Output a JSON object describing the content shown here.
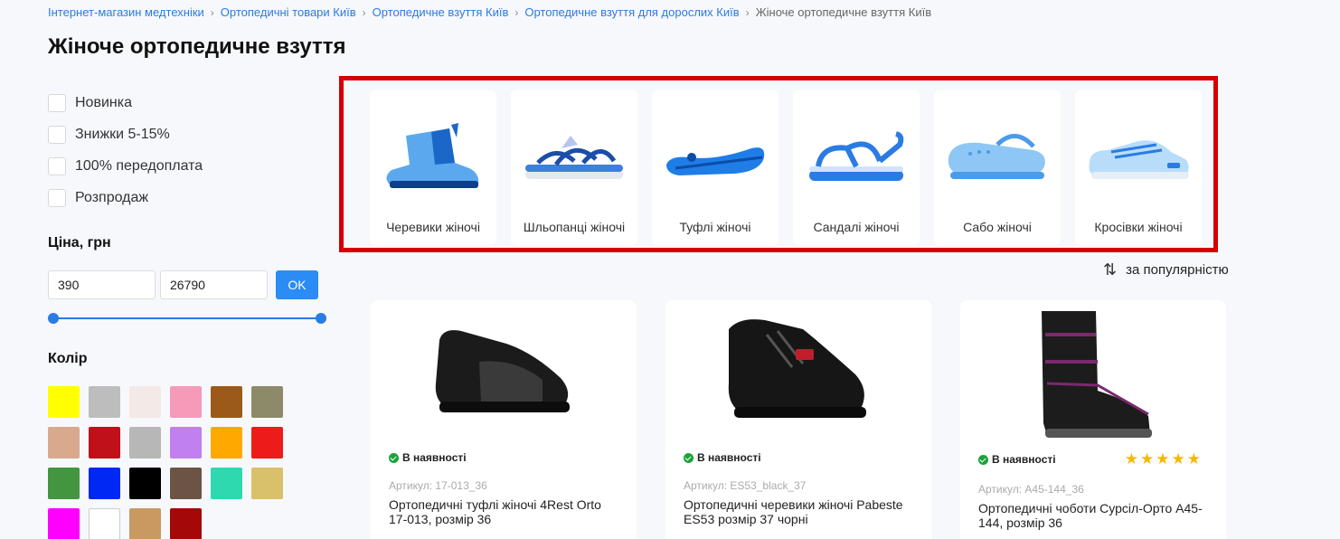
{
  "breadcrumb": [
    "Інтернет-магазин медтехніки",
    "Ортопедичні товари Київ",
    "Ортопедичне взуття Київ",
    "Ортопедичне взуття для дорослих Київ"
  ],
  "breadcrumb_current": "Жіноче ортопедичне взуття Київ",
  "page_title": "Жіноче ортопедичне взуття",
  "filters": {
    "checkboxes": [
      "Новинка",
      "Знижки 5-15%",
      "100% передоплата",
      "Розпродаж"
    ],
    "price_title": "Ціна, грн",
    "price_min": "390",
    "price_max": "26790",
    "ok_label": "OK",
    "color_title": "Колір",
    "colors": [
      {
        "name": "yellow",
        "color": "#ffff00"
      },
      {
        "name": "grey",
        "color": "#bdbdbd"
      },
      {
        "name": "floral-pattern",
        "color": "#f3e9e6"
      },
      {
        "name": "pink",
        "color": "#f59ab8"
      },
      {
        "name": "brown",
        "color": "#9c5a1a"
      },
      {
        "name": "camouflage",
        "color": "#8d8a6a"
      },
      {
        "name": "beige",
        "color": "#d9a98e"
      },
      {
        "name": "red-black",
        "color": "#c0101a"
      },
      {
        "name": "grey-pattern",
        "color": "#b7b7b7"
      },
      {
        "name": "multicolor",
        "color": "#c080f0"
      },
      {
        "name": "orange",
        "color": "#ffa800"
      },
      {
        "name": "red",
        "color": "#ee1b1b"
      },
      {
        "name": "green",
        "color": "#43963f"
      },
      {
        "name": "blue",
        "color": "#0028f5"
      },
      {
        "name": "black",
        "color": "#000000"
      },
      {
        "name": "snake-pattern",
        "color": "#6b5446"
      },
      {
        "name": "turquoise",
        "color": "#2ed9b0"
      },
      {
        "name": "gold",
        "color": "#d9c06a"
      },
      {
        "name": "magenta",
        "color": "#ff00ff"
      },
      {
        "name": "white",
        "color": "#ffffff"
      },
      {
        "name": "leopard",
        "color": "#c89a62"
      },
      {
        "name": "dark-red",
        "color": "#a50808"
      }
    ]
  },
  "categories": [
    "Черевики жіночі",
    "Шльопанці жіночі",
    "Туфлі жіночі",
    "Сандалі жіночі",
    "Сабо жіночі",
    "Кросівки жіночі"
  ],
  "sort_label": "за популярністю",
  "products": [
    {
      "stock": "В наявності",
      "sku": "Артикул: 17-013_36",
      "name": "Ортопедичні туфлі жіночі 4Rest Orto 17-013, розмір 36"
    },
    {
      "stock": "В наявності",
      "sku": "Артикул: ES53_black_37",
      "name": "Ортопедичні черевики жіночі Pabeste ES53 розмір 37 чорні"
    },
    {
      "stock": "В наявності",
      "sku": "Артикул: A45-144_36",
      "name": "Ортопедичні чоботи Сурсіл-Орто А45-144, розмір 36",
      "stars": "★★★★★",
      "rating": 5
    }
  ]
}
